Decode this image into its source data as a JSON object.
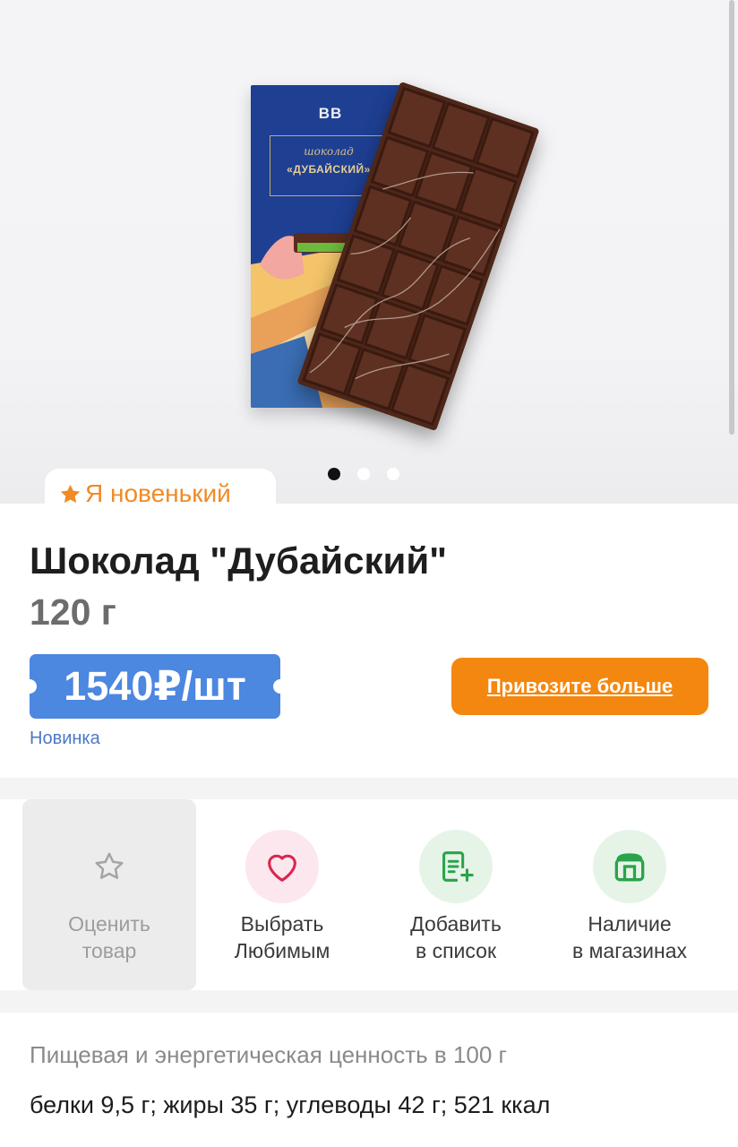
{
  "product_image": {
    "package_brand": "BB",
    "package_label_small": "шоколад",
    "package_label_big": "«ДУБАЙСКИЙ»",
    "slides_total": 3,
    "slide_active": 1
  },
  "badge": {
    "icon": "star-icon",
    "text": "Я новенький",
    "color": "#f08b25"
  },
  "product": {
    "title": "Шоколад \"Дубайский\"",
    "weight": "120 г",
    "price": "1540₽/шт",
    "tag": "Новинка"
  },
  "buttons": {
    "bring_more": "Привозите больше"
  },
  "actions": [
    {
      "icon": "star-outline-icon",
      "label_line1": "Оценить",
      "label_line2": "товар"
    },
    {
      "icon": "heart-icon",
      "label_line1": "Выбрать",
      "label_line2": "Любимым"
    },
    {
      "icon": "list-add-icon",
      "label_line1": "Добавить",
      "label_line2": "в список"
    },
    {
      "icon": "store-icon",
      "label_line1": "Наличие",
      "label_line2": "в магазинах"
    }
  ],
  "nutrition": {
    "title": "Пищевая и энергетическая ценность в 100 г",
    "values": "белки 9,5 г; жиры 35 г; углеводы 42 г; 521 ккал"
  },
  "colors": {
    "accent_orange": "#f3870f",
    "price_blue": "#4c87e0",
    "link_blue": "#4c78c8",
    "heart_red": "#d8264e",
    "green": "#2aa34a"
  }
}
